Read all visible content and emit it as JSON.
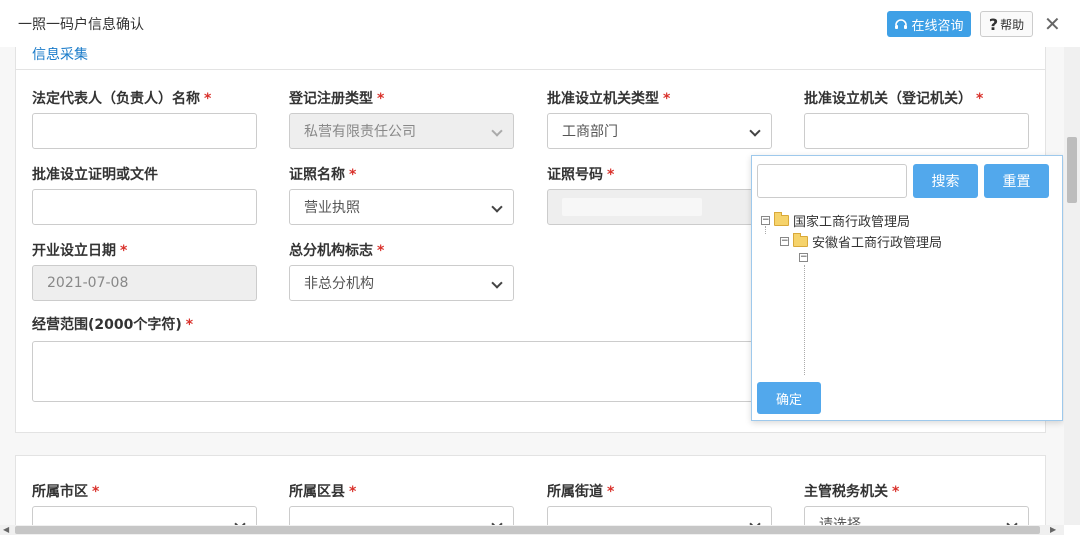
{
  "window": {
    "title": "一照一码户信息确认",
    "consult_label": "在线咨询",
    "help_label": "帮助",
    "close_glyph": "✕"
  },
  "section": {
    "title": "信息采集"
  },
  "fields": {
    "legal_rep": {
      "label": "法定代表人（负责人）名称",
      "value": ""
    },
    "reg_type": {
      "label": "登记注册类型",
      "value": "私营有限责任公司"
    },
    "approval_org_type": {
      "label": "批准设立机关类型",
      "value": "工商部门"
    },
    "approval_org": {
      "label": "批准设立机关（登记机关）",
      "value": ""
    },
    "approval_doc": {
      "label": "批准设立证明或文件",
      "value": ""
    },
    "license_name": {
      "label": "证照名称",
      "value": "营业执照"
    },
    "license_no": {
      "label": "证照号码",
      "value": ""
    },
    "open_date": {
      "label": "开业设立日期",
      "value": "2021-07-08"
    },
    "branch_flag": {
      "label": "总分机构标志",
      "value": "非总分机构"
    },
    "business_scope": {
      "label": "经营范围(2000个字符)",
      "value": ""
    },
    "city": {
      "label": "所属市区",
      "value": ""
    },
    "county": {
      "label": "所属区县",
      "value": ""
    },
    "street": {
      "label": "所属街道",
      "value": ""
    },
    "tax_authority": {
      "label": "主管税务机关",
      "value": "请选择"
    }
  },
  "required_mark": "*",
  "tree_popup": {
    "search_label": "搜索",
    "reset_label": "重置",
    "confirm_label": "确定",
    "nodes": [
      {
        "label": "国家工商行政管理局",
        "level": 0
      },
      {
        "label": "安徽省工商行政管理局",
        "level": 1
      }
    ]
  },
  "colors": {
    "accent": "#52a8ec",
    "required": "#d9312b",
    "section_title": "#1a7bc9"
  }
}
